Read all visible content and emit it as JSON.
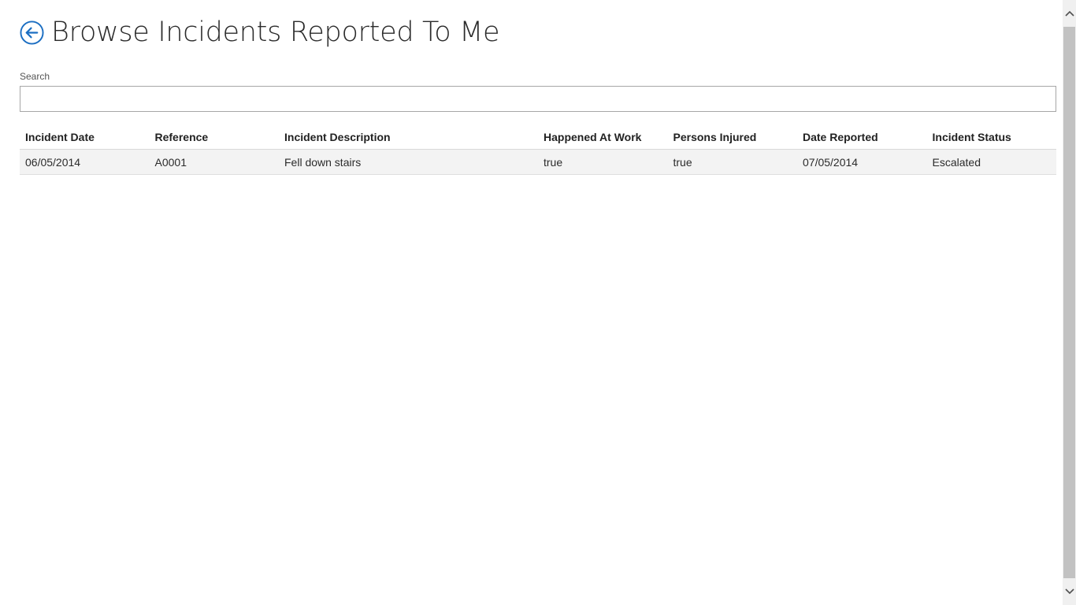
{
  "header": {
    "title": "Browse Incidents Reported To Me",
    "back_icon": "back-arrow-circle-icon",
    "accent_color": "#1b6ec2"
  },
  "search": {
    "label": "Search",
    "value": "",
    "placeholder": ""
  },
  "table": {
    "columns": [
      "Incident Date",
      "Reference",
      "Incident Description",
      "Happened At Work",
      "Persons Injured",
      "Date Reported",
      "Incident Status"
    ],
    "rows": [
      {
        "incident_date": "06/05/2014",
        "reference": "A0001",
        "description": "Fell down stairs",
        "happened_at_work": "true",
        "persons_injured": "true",
        "date_reported": "07/05/2014",
        "status": "Escalated"
      }
    ]
  },
  "scrollbar": {
    "up_icon": "chevron-up-icon",
    "down_icon": "chevron-down-icon"
  }
}
